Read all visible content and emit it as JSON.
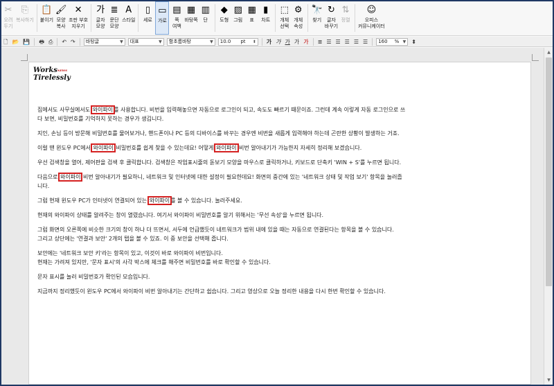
{
  "ribbon": {
    "items": [
      {
        "label": "오려\n두기",
        "icon": "✂",
        "disabled": true
      },
      {
        "label": "복사하기",
        "icon": "⎘",
        "disabled": true
      },
      {
        "label": "붙이기",
        "icon": "📋",
        "disabled": false
      },
      {
        "label": "모양\n복사",
        "icon": "🖌",
        "disabled": false
      },
      {
        "label": "조판 부호\n지우기",
        "icon": "✕",
        "disabled": false
      },
      {
        "label": "글자\n모양",
        "icon": "가",
        "disabled": false
      },
      {
        "label": "문단\n모양",
        "icon": "≣",
        "disabled": false
      },
      {
        "label": "스타일",
        "icon": "A",
        "disabled": false
      },
      {
        "label": "세로",
        "icon": "▯",
        "disabled": false
      },
      {
        "label": "가로",
        "icon": "▭",
        "disabled": false,
        "active": true
      },
      {
        "label": "쪽\n여백",
        "icon": "▤",
        "disabled": false
      },
      {
        "label": "바탕쪽",
        "icon": "▦",
        "disabled": false
      },
      {
        "label": "단",
        "icon": "▥",
        "disabled": false
      },
      {
        "label": "도형",
        "icon": "◆",
        "disabled": false
      },
      {
        "label": "그림",
        "icon": "▨",
        "disabled": false
      },
      {
        "label": "표",
        "icon": "▦",
        "disabled": false
      },
      {
        "label": "차트",
        "icon": "▮",
        "disabled": false
      },
      {
        "label": "개체\n선택",
        "icon": "⬚",
        "disabled": false
      },
      {
        "label": "개체\n속성",
        "icon": "⚙",
        "disabled": false
      },
      {
        "label": "찾기",
        "icon": "🔭",
        "disabled": false
      },
      {
        "label": "글자\n바꾸기",
        "icon": "↻",
        "disabled": false
      },
      {
        "label": "정렬",
        "icon": "⇅",
        "disabled": true
      },
      {
        "label": "오피스\n커뮤니케이터",
        "icon": "☺",
        "disabled": false
      }
    ]
  },
  "format": {
    "style": "바탕글",
    "font_lang": "대표",
    "font": "함초롬바탕",
    "size": "10.0",
    "size_unit": "pt",
    "zoom": "160",
    "zoom_unit": "%"
  },
  "logo": {
    "line1": "Works",
    "sup": "NEWS",
    "line2": "Tirelessly"
  },
  "paragraphs": [
    [
      [
        {
          "t": "집에서도 사무실에서도 "
        },
        {
          "t": "와이파이",
          "hl": true
        },
        {
          "t": "를 사용합니다. 비번을 입력해놓으면 자동으로 로그인이 되고, 속도도 빠르기 때문이죠. 그런데 계속 이렇게 자동 로그인으로 쓰"
        }
      ],
      [
        {
          "t": "다 보면, 비밀번호를 기억하지 못하는 경우가 생깁니다."
        }
      ]
    ],
    [
      [
        {
          "t": "지인, 손님 등이 방문해 비밀번호를 물어보거나, 핸드폰이나 PC 등의 디바이스를 바꾸는 경우엔 비번을 새롭게 입력해야 하는데 곤란한 상황이 발생하는 거죠."
        }
      ]
    ],
    [
      [
        {
          "t": "이럴 땐 윈도우 PC에서 "
        },
        {
          "t": "와이파이",
          "hl": true
        },
        {
          "t": " 비밀번호를 쉽게 찾을 수 있는데요! 어떻게 "
        },
        {
          "t": "와이파이",
          "hl": true
        },
        {
          "t": " 비번 알아내기가 가능한지 자세히 정리해 보겠습니다."
        }
      ]
    ],
    [
      [
        {
          "t": "우선 검색창을 열어, 제어판을 검색 후 클릭합니다. 검색창은 작업표시줄의 돋보기 모양을 마우스로 클릭하거나, 키보드로 단축키 'WIN + S'를 누르면 됩니다."
        }
      ]
    ],
    [
      [
        {
          "t": "다음으로 "
        },
        {
          "t": "와이파이",
          "hl": true
        },
        {
          "t": " 비번 알아내기가 필요하니, 네트워크 및 인터넷에 대한 설정이 필요한데요! 화면의 중간에 있는 '네트워크 상태 및 작업 보기' 항목을 눌러줍"
        }
      ],
      [
        {
          "t": "니다."
        }
      ]
    ],
    [
      [
        {
          "t": "그럼 현재 윈도우 PC가 인터넷이 연결되어 있는 "
        },
        {
          "t": "와이파이",
          "hl": true
        },
        {
          "t": "를 볼 수 있습니다. 눌러주세요."
        }
      ]
    ],
    [
      [
        {
          "t": "현재의 와이파이 상태를 알려주는 창이 열렸습니다. 여기서 와이파이 비밀번호를 알기 위해서는 '무선 속성'을 누르면 됩니다."
        }
      ]
    ],
    [
      [
        {
          "t": "그럼 화면의 오른쪽에 비슷한 크기의 창이 하나 더 뜨면서, 서두에 언급했듯이 네트워크가 범위 내에 있을 때는 자동으로 연결된다는 항목을 볼 수 있습니다."
        }
      ],
      [
        {
          "t": "그리고 상단에는 '연결과 보안' 2개의 탭을 볼 수 있죠. 이 중 보안을 선택해 줍니다."
        }
      ]
    ],
    [
      [
        {
          "t": "보안에는 '네트워크 보안 키'라는 항목이 있고, 이것이 바로 와이파이 비번입니다."
        }
      ],
      [
        {
          "t": "현재는 가려져 있지만, '문자 표시'의 사각 박스에 체크를 해주면 비밀번호를 바로 확인할 수 있습니다."
        }
      ]
    ],
    [
      [
        {
          "t": "문자 표시를 눌러 비밀번호가 확인된 모습입니다."
        }
      ]
    ],
    [
      [
        {
          "t": "지금까지 정리했듯이 윈도우 PC에서 와이파이 비번 알아내기는 간단하고 쉽습니다. 그리고 영상으로 오늘 정리한 내용을 다시 한번 확인할 수 있습니다."
        }
      ]
    ]
  ]
}
